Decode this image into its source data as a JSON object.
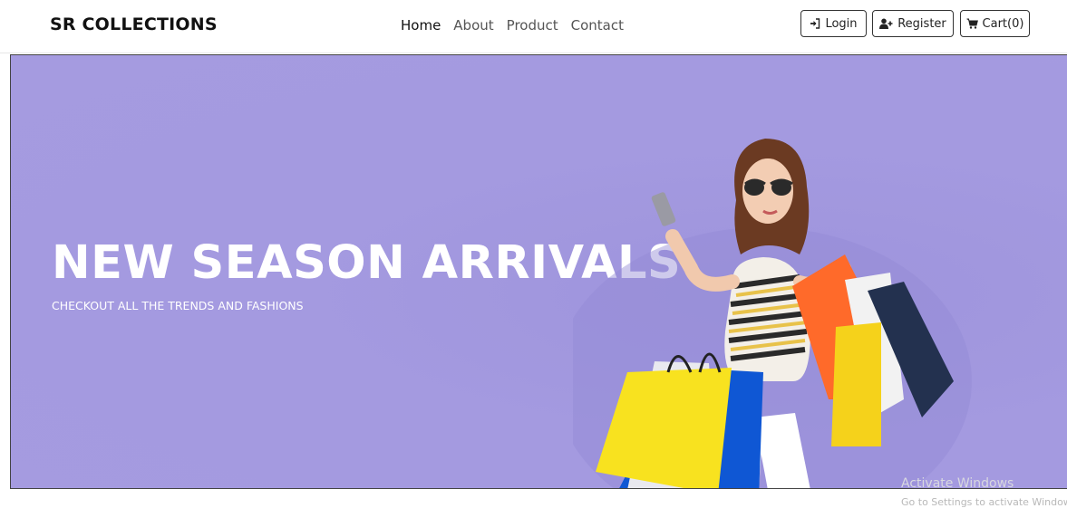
{
  "brand": "SR COLLECTIONS",
  "nav": {
    "links": [
      "Home",
      "About",
      "Product",
      "Contact"
    ],
    "active": "Home"
  },
  "actions": {
    "login": "Login",
    "register": "Register",
    "cart": "Cart(0)"
  },
  "icons": {
    "login": "sign-in-icon",
    "register": "user-plus-icon",
    "cart": "shopping-cart-icon"
  },
  "hero": {
    "title": "NEW SEASON ARRIVALS",
    "subtitle": "CHECKOUT ALL THE TRENDS AND FASHIONS",
    "image": "woman-with-shopping-bags"
  },
  "watermark": {
    "line1": "Activate Windows",
    "line2": "Go to Settings to activate Windows."
  },
  "colors": {
    "hero_background": "#a59be0",
    "text_white": "#ffffff",
    "brand_text": "#111111"
  }
}
